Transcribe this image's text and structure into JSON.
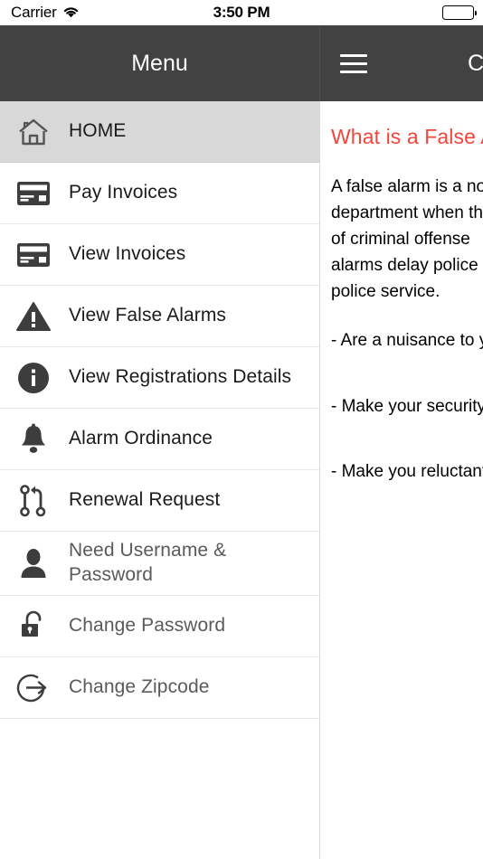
{
  "status_bar": {
    "carrier": "Carrier",
    "wifi_icon": "wifi-icon",
    "time": "3:50 PM",
    "battery_icon": "battery-full-icon"
  },
  "drawer_nav": {
    "title": "Menu"
  },
  "content_nav": {
    "menu_icon": "hamburger-menu-icon",
    "title": "C"
  },
  "menu": {
    "items": [
      {
        "label": "HOME",
        "icon": "home-icon",
        "active": true,
        "dim": false
      },
      {
        "label": "Pay Invoices",
        "icon": "credit-card-icon",
        "active": false,
        "dim": false
      },
      {
        "label": "View Invoices",
        "icon": "credit-card-icon",
        "active": false,
        "dim": false
      },
      {
        "label": "View False Alarms",
        "icon": "warning-triangle-icon",
        "active": false,
        "dim": false
      },
      {
        "label": "View Registrations Details",
        "icon": "info-circle-icon",
        "active": false,
        "dim": false
      },
      {
        "label": "Alarm Ordinance",
        "icon": "bell-icon",
        "active": false,
        "dim": false
      },
      {
        "label": "Renewal Request",
        "icon": "pull-request-icon",
        "active": false,
        "dim": false
      },
      {
        "label": "Need Username & Password",
        "icon": "user-icon",
        "active": false,
        "dim": true
      },
      {
        "label": "Change Password",
        "icon": "unlock-icon",
        "active": false,
        "dim": true
      },
      {
        "label": "Change Zipcode",
        "icon": "sign-out-icon",
        "active": false,
        "dim": true
      }
    ]
  },
  "content": {
    "heading": "What is a False A",
    "paragraph": "A false alarm is a no\ndepartment when th\nof criminal offense \nalarms delay police\npolice service.",
    "bullets": [
      "- Are a nuisance to y",
      "- Make your security",
      "- Make you reluctant"
    ]
  },
  "colors": {
    "navbar": "#424242",
    "accent_red": "#f4453a",
    "active_row": "#d8d8d8",
    "icon_dark": "#3d3d3d"
  }
}
